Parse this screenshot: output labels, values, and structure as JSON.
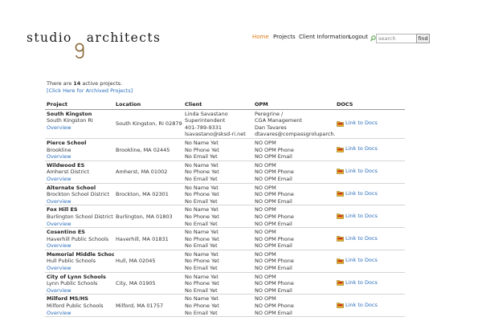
{
  "brand": {
    "logo_left": "studio",
    "logo_mark": "g",
    "logo_right": "architects"
  },
  "nav": {
    "items": [
      "Home",
      "Projects",
      "Client Information",
      "Logout"
    ],
    "active": "Home"
  },
  "search": {
    "placeholder": "search",
    "button_label": "find"
  },
  "summary": {
    "prefix": "There are ",
    "count": "14",
    "suffix": " active projects.",
    "archived_link": "[Click Here for Archived Projects]"
  },
  "table": {
    "headers": [
      "Project",
      "Location",
      "Client",
      "OPM",
      "DOCS"
    ],
    "rows": [
      {
        "name": "South Kingston",
        "sub": "South Kingston RI",
        "overview": "Overview",
        "location": "South Kingston, RI 02879",
        "client": [
          "Linda Savastano",
          "Superintendent",
          "401-789-9331",
          "lsavastano@sksd-ri.net"
        ],
        "opm": [
          "Peregrine /",
          "CGA Management",
          "Dan Tavares",
          "dtavares@compassgroluparch.com"
        ],
        "docs": "Link to Docs"
      },
      {
        "name": "Pierce School",
        "sub": "Brookline",
        "overview": "Overview",
        "location": "Brookline, MA 02445",
        "client": [
          "No Name Yet",
          "No Phone Yet",
          "No Email Yet"
        ],
        "opm": [
          "NO OPM",
          "NO OPM Phone",
          "NO OPM Email"
        ],
        "docs": "Link to Docs"
      },
      {
        "name": "Wildwood ES",
        "sub": "Amherst District",
        "overview": "Overview",
        "location": "Amherst, MA 01002",
        "client": [
          "No Name Yet",
          "No Phone Yet",
          "No Email Yet"
        ],
        "opm": [
          "NO OPM",
          "NO OPM Phone",
          "NO OPM Email"
        ],
        "docs": "Link to Docs"
      },
      {
        "name": "Alternate School",
        "sub": "Brockton School District",
        "overview": "Overview",
        "location": "Brockton, MA 02301",
        "client": [
          "No Name Yet",
          "No Phone Yet",
          "No Email Yet"
        ],
        "opm": [
          "NO OPM",
          "NO OPM Phone",
          "NO OPM Email"
        ],
        "docs": "Link to Docs"
      },
      {
        "name": "Fox Hill ES",
        "sub": "Burlington School District",
        "overview": "Overview",
        "location": "Burlington, MA 01803",
        "client": [
          "No Name Yet",
          "No Phone Yet",
          "No Email Yet"
        ],
        "opm": [
          "NO OPM",
          "NO OPM Phone",
          "NO OPM Email"
        ],
        "docs": "Link to Docs"
      },
      {
        "name": "Cosentino ES",
        "sub": "Haverhill Public Schools",
        "overview": "Overview",
        "location": "Haverhill, MA 01831",
        "client": [
          "No Name Yet",
          "No Phone Yet",
          "No Email Yet"
        ],
        "opm": [
          "NO OPM",
          "NO OPM Phone",
          "NO OPM Email"
        ],
        "docs": "Link to Docs"
      },
      {
        "name": "Memorial Middle School",
        "sub": "Hull Public Schools",
        "overview": "Overview",
        "location": "Hull, MA 02045",
        "client": [
          "No Name Yet",
          "No Phone Yet",
          "No Email Yet"
        ],
        "opm": [
          "NO OPM",
          "NO OPM Phone",
          "NO OPM Email"
        ],
        "docs": "Link to Docs"
      },
      {
        "name": "City of Lynn Schools",
        "sub": "Lynn Public Schools",
        "overview": "Overview",
        "location": "City, MA 01905",
        "client": [
          "No Name Yet",
          "No Phone Yet",
          "No Email Yet"
        ],
        "opm": [
          "NO OPM",
          "NO OPM Phone",
          "NO OPM Email"
        ],
        "docs": "Link to Docs"
      },
      {
        "name": "Milford MS/HS",
        "sub": "Milford Public Schools",
        "overview": "Overview",
        "location": "Milford, MA 01757",
        "client": [
          "No Name Yet",
          "No Phone Yet",
          "No Email Yet"
        ],
        "opm": [
          "NO OPM",
          "NO OPM Phone",
          "NO OPM Email"
        ],
        "docs": "Link to Docs"
      }
    ]
  },
  "colors": {
    "accent": "#e07c16",
    "link": "#2a6ebb",
    "text": "#333333"
  },
  "icons": {
    "search": "search-icon",
    "docs": "folder-icon"
  }
}
